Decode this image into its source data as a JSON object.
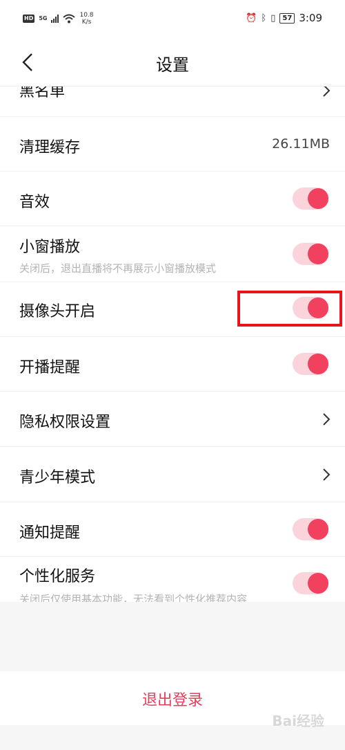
{
  "status_bar": {
    "hd": "HD",
    "signal": "5G",
    "speed_value": "10.8",
    "speed_unit": "K/s",
    "battery": "57",
    "time": "3:09"
  },
  "header": {
    "title": "设置"
  },
  "rows": [
    {
      "label": "黑名单",
      "type": "chevron"
    },
    {
      "label": "清理缓存",
      "type": "value",
      "value": "26.11MB"
    },
    {
      "label": "音效",
      "type": "toggle",
      "on": true
    },
    {
      "label": "小窗播放",
      "type": "toggle",
      "on": true,
      "sub": "关闭后，退出直播将不再展示小窗播放模式"
    },
    {
      "label": "摄像头开启",
      "type": "toggle",
      "on": true
    },
    {
      "label": "开播提醒",
      "type": "toggle",
      "on": true
    },
    {
      "label": "隐私权限设置",
      "type": "chevron"
    },
    {
      "label": "青少年模式",
      "type": "chevron"
    },
    {
      "label": "通知提醒",
      "type": "toggle",
      "on": true
    },
    {
      "label": "个性化服务",
      "type": "toggle",
      "on": true,
      "sub": "关闭后仅使用基本功能，无法看到个性化推荐内容"
    }
  ],
  "logout": {
    "label": "退出登录"
  },
  "watermark": "Bai经验",
  "colors": {
    "accent": "#f2405f",
    "toggle_track": "#fbd3da",
    "highlight": "#e8141b"
  }
}
